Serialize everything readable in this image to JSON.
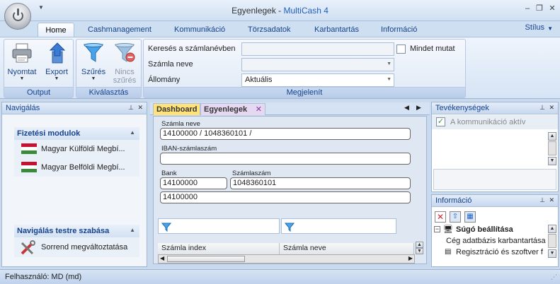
{
  "window": {
    "title_doc": "Egyenlegek",
    "title_sep": " - ",
    "title_app": "MultiCash 4"
  },
  "ribbon_tabs": [
    "Home",
    "Cashmanagement",
    "Kommunikáció",
    "Törzsadatok",
    "Karbantartás",
    "Információ"
  ],
  "stilus_label": "Stílus",
  "groups": {
    "output": {
      "label": "Output",
      "print": "Nyomtat",
      "export": "Export"
    },
    "filter": {
      "label": "Kiválasztás",
      "filters": "Szűrés",
      "no_filter_line1": "Nincs",
      "no_filter_line2": "szűrés"
    },
    "display": {
      "label": "Megjelenít",
      "search_label": "Keresés a számlanévben",
      "search_value": "",
      "account_label": "Számla neve",
      "account_value": "",
      "status_label": "Állomány",
      "status_value": "Aktuális",
      "show_all_label": "Mindet mutat"
    }
  },
  "navigation": {
    "title": "Navigálás",
    "payment_modules": {
      "title": "Fizetési modulok",
      "items": [
        "Magyar Külföldi Megbí...",
        "Magyar Belföldi Megbí..."
      ]
    },
    "customize": {
      "title": "Navigálás testre szabása",
      "items": [
        "Sorrend megváltoztatása"
      ]
    }
  },
  "doc_tabs": [
    "Dashboard",
    "Egyenlegek"
  ],
  "form": {
    "account_name_label": "Számla neve",
    "account_name_value": "14100000 / 1048360101 /",
    "iban_label": "IBAN-számlaszám",
    "iban_value": "",
    "bank_label": "Bank",
    "bank_value": "14100000",
    "account_no_label": "Számlaszám",
    "account_no_value": "1048360101",
    "extra_value": "14100000",
    "grid_columns": [
      "Számla index",
      "Számla neve"
    ]
  },
  "activities": {
    "title": "Tevékenységek",
    "items": [
      "A kommunikáció aktív"
    ]
  },
  "info": {
    "title": "Információ",
    "tree": [
      {
        "label": "Súgó beállítása",
        "bold": true
      },
      {
        "label": "Cég adatbázis karbantartása",
        "bold": false
      },
      {
        "label": "Regisztráció és szoftver f",
        "bold": false
      }
    ]
  },
  "status": {
    "user_label": "Felhasználó: MD (md)"
  },
  "colors": {
    "accent": "#15428b",
    "dashboard_tab": "#ffe27a",
    "active_tab": "#e6d8f0",
    "check_green": "#3a9a3a"
  }
}
